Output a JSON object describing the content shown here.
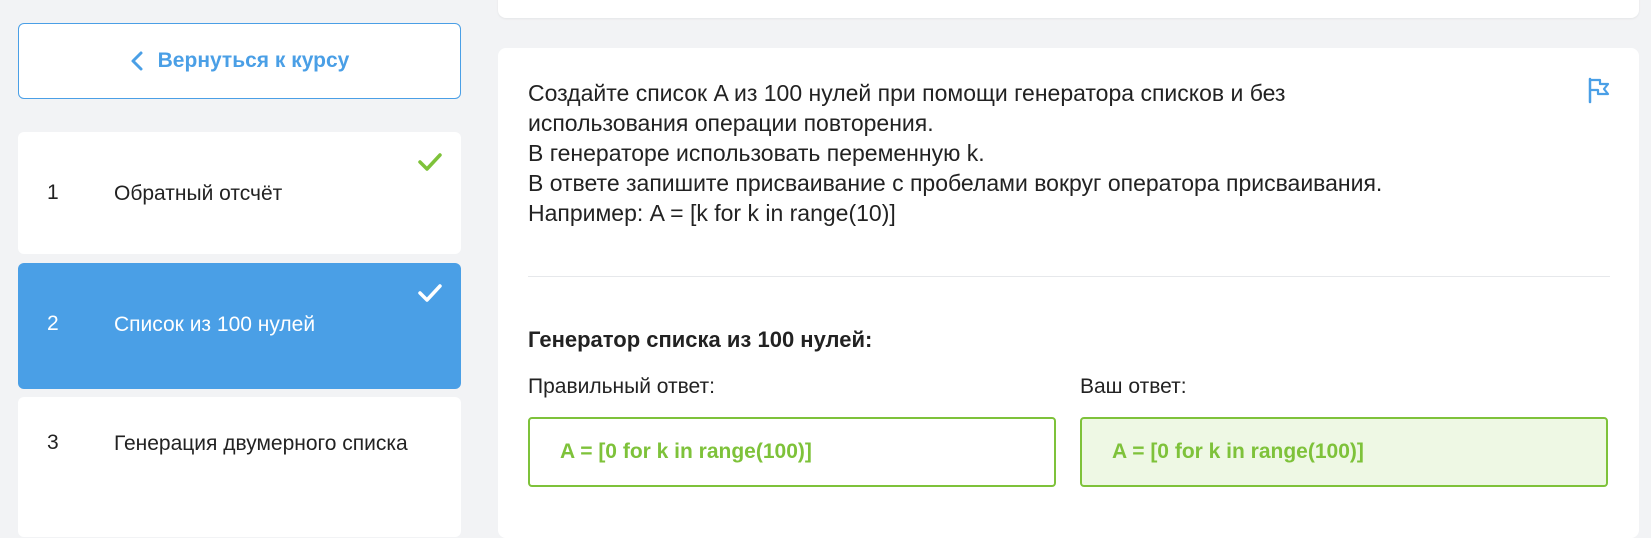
{
  "sidebar": {
    "back_label": "Вернуться к курсу",
    "lessons": [
      {
        "number": "1",
        "title": "Обратный отсчёт",
        "completed": true,
        "active": false
      },
      {
        "number": "2",
        "title": "Список из 100 нулей",
        "completed": true,
        "active": true
      },
      {
        "number": "3",
        "title": "Генерация двумерного списка",
        "completed": false,
        "active": false
      }
    ]
  },
  "task": {
    "lines": [
      "Создайте список A из 100 нулей при помощи генератора списков и без",
      "использования операции повторения.",
      "В генераторе использовать переменную k.",
      "В ответе запишите присваивание с пробелами вокруг оператора присваивания.",
      "Например: A = [k for k in range(10)]"
    ],
    "answer_heading": "Генератор списка из 100 нулей:",
    "correct_label": "Правильный ответ:",
    "correct_value": "A = [0 for k in range(100)]",
    "your_label": "Ваш ответ:",
    "your_value": "A = [0 for k in range(100)]"
  },
  "colors": {
    "accent": "#4a9fe6",
    "success": "#7ec23a",
    "success_bg": "#eef8e4"
  },
  "icons": {
    "back": "chevron-left-icon",
    "completed": "check-icon",
    "report": "flag-icon"
  }
}
